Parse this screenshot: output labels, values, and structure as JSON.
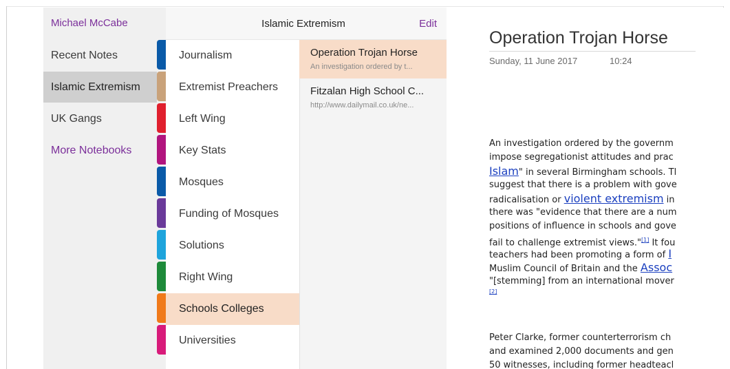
{
  "user_name": "Michael McCabe",
  "notebooks": [
    "Recent Notes",
    "Islamic Extremism",
    "UK Gangs"
  ],
  "more_notebooks": "More Notebooks",
  "header": {
    "title": "Islamic Extremism",
    "edit": "Edit"
  },
  "sections": [
    "Journalism",
    "Extremist Preachers",
    "Left Wing",
    "Key Stats",
    "Mosques",
    "Funding of Mosques",
    "Solutions",
    "Right Wing",
    "Schools Colleges",
    "Universities"
  ],
  "section_colors": [
    "#0a5aa8",
    "#c9a27a",
    "#e0202e",
    "#b1157e",
    "#0a5aa8",
    "#6a3a9a",
    "#1ea4dc",
    "#1e8a3a",
    "#f07a1a",
    "#d81b7a"
  ],
  "pages": [
    {
      "title": "Operation Trojan Horse",
      "snippet": "An investigation ordered by t..."
    },
    {
      "title": "Fitzalan High School C...",
      "snippet": "http://www.dailymail.co.uk/ne..."
    }
  ],
  "note": {
    "title": "Operation Trojan Horse",
    "date": "Sunday, 11 June 2017",
    "time": "10:24",
    "p1": {
      "l1": "An investigation ordered by the governm",
      "l2": "impose segregationist attitudes and prac",
      "l3_link": "Islam",
      "l3_text": "\" in several Birmingham schools. Tl",
      "l4": "suggest that there is a problem with gove",
      "l5_text": "radicalisation or ",
      "l5_link": "violent extremism",
      "l5_tail": " in",
      "l6": "there was \"evidence that there are a num",
      "l7": "positions of influence in schools and gove",
      "l8_text": "fail to challenge extremist views.\"",
      "l8_ref": "[1]",
      "l8_tail": " It fou",
      "l9_text": "teachers had been promoting a form of ",
      "l9_link": "I",
      "l10_text": "Muslim Council of Britain and the ",
      "l10_link": "Assoc",
      "l11": "\"[stemming] from an international mover",
      "l12_ref": "[2]"
    },
    "p2": {
      "l1": "Peter Clarke, former counterterrorism ch",
      "l2": "and examined 2,000 documents and gen",
      "l3": "50 witnesses, including former headteacl"
    }
  }
}
